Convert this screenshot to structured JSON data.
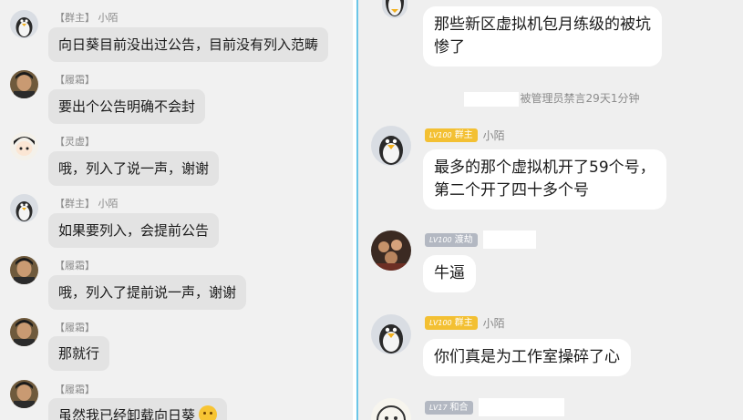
{
  "left_chat": {
    "messages": [
      {
        "role": "【群主】",
        "name": "小陌",
        "text": "向日葵目前没出过公告，目前没有列入范畴",
        "avatar_icon": "penguin-avatar-icon"
      },
      {
        "role": "【履霜】",
        "name": "",
        "text": "要出个公告明确不会封",
        "avatar_icon": "person-avatar-icon"
      },
      {
        "role": "【灵虚】",
        "name": "",
        "text": "哦，列入了说一声，谢谢",
        "avatar_icon": "anime-avatar-icon"
      },
      {
        "role": "【群主】",
        "name": "小陌",
        "text": "如果要列入，会提前公告",
        "avatar_icon": "penguin-avatar-icon"
      },
      {
        "role": "【履霜】",
        "name": "",
        "text": "哦，列入了提前说一声，谢谢",
        "avatar_icon": "person-avatar-icon"
      },
      {
        "role": "【履霜】",
        "name": "",
        "text": "那就行",
        "avatar_icon": "person-avatar-icon"
      },
      {
        "role": "【履霜】",
        "name": "",
        "text": "虽然我已经卸载向日葵",
        "avatar_icon": "person-avatar-icon"
      }
    ]
  },
  "right_chat": {
    "top_bubble": "那些新区虚拟机包月练级的被坑\n惨了",
    "system_note": "被管理员禁言29天1分钟",
    "messages": [
      {
        "level": "LV100",
        "title": "群主",
        "name": "小陌",
        "badge_color": "#f3c033",
        "text": "最多的那个虚拟机开了59个号，\n第二个开了四十多个号",
        "avatar_icon": "penguin-avatar-icon"
      },
      {
        "level": "LV100",
        "title": "渡劫",
        "name": "",
        "badge_color": "#b3b8c2",
        "text": "牛逼",
        "avatar_icon": "group-photo-avatar-icon"
      },
      {
        "level": "LV100",
        "title": "群主",
        "name": "小陌",
        "badge_color": "#f3c033",
        "text": "你们真是为工作室操碎了心",
        "avatar_icon": "penguin-avatar-icon"
      },
      {
        "level": "LV17",
        "title": "和合",
        "name": "",
        "badge_color": "#b3b8c2",
        "text": "",
        "avatar_icon": "cartoon-avatar-icon"
      }
    ]
  }
}
